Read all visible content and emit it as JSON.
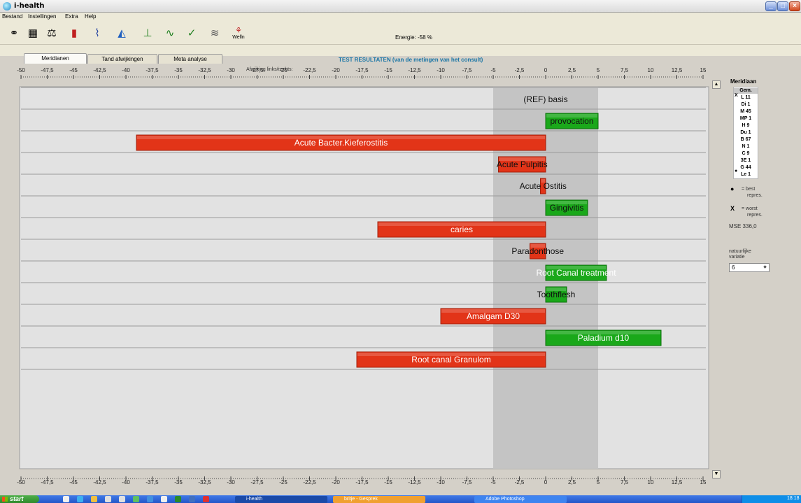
{
  "window": {
    "title": "i-health"
  },
  "menu": [
    "Bestand",
    "Instellingen",
    "Extra",
    "Help"
  ],
  "toolbar": {
    "icons": [
      "binoculars-icon",
      "table-icon",
      "scale-icon",
      "bar-chart-icon",
      "line-chart-icon",
      "area-chart-icon",
      "tree-chart-icon",
      "wave-chart-icon",
      "check-pulse-icon",
      "spectrum-icon",
      "welln-icon"
    ],
    "welln_label": "Welln",
    "energy_label": "Energie: -58 %"
  },
  "tabs": [
    "Meridianen",
    "Tand afwijkingen",
    "Meta analyse"
  ],
  "result_title": "TEST RESULTATEN (van de metingen van het consult)",
  "axis_caption": "Afwijking links/rechts:",
  "chart_data": {
    "type": "bar",
    "orientation": "horizontal",
    "xlim": [
      -50,
      15
    ],
    "tick_labels": [
      "-50",
      "-47,5",
      "-45",
      "-42,5",
      "-40",
      "-37,5",
      "-35",
      "-32,5",
      "-30",
      "-27,5",
      "-25",
      "-22,5",
      "-20",
      "-17,5",
      "-15",
      "-12,5",
      "-10",
      "-7,5",
      "-5",
      "-2,5",
      "0",
      "2,5",
      "5",
      "7,5",
      "10",
      "12,5",
      "15"
    ],
    "band": [
      -5,
      5
    ],
    "categories": [
      "(REF) basis",
      "provocation",
      "Acute Bacter.Kieferostitis",
      "Acute Pulpitis",
      "Acute Ostitis",
      "Gingivitis",
      "caries",
      "Paradonthose",
      "Root Canal treatment",
      "Toothflesh",
      "Amalgam D30",
      "Paladium d10",
      "Root canal Granulom"
    ],
    "values": [
      0,
      5,
      -39,
      -4.5,
      -0.5,
      4,
      -16,
      -1.5,
      5.8,
      2,
      -10,
      11,
      -18
    ],
    "colors": {
      "positive": "#1aa81a",
      "negative": "#e23418",
      "band": "#c4c4c4",
      "bg": "#e2e2e2"
    },
    "grid": true
  },
  "sidebar": {
    "title": "Meridiaan",
    "list": [
      "Gem.",
      "L 11",
      "Di 1",
      "M 45",
      "MP 1",
      "H 9",
      "Du 1",
      "B 67",
      "N 1",
      "C 9",
      "3E 1",
      "G 44",
      "Le 1"
    ],
    "list_marks": {
      "worst": "X",
      "best": "●"
    },
    "legend_best": [
      "= best",
      "repres."
    ],
    "legend_worst": [
      "= worst",
      "repres."
    ],
    "mse": "MSE 336,0",
    "natural_label": [
      "natuurlijke",
      "variatie"
    ],
    "natural_value": "6"
  },
  "taskbar": {
    "start": "start",
    "items": [
      "i-health",
      "britje - Gesprek",
      "Adobe Photoshop"
    ],
    "clock": "18:18"
  }
}
